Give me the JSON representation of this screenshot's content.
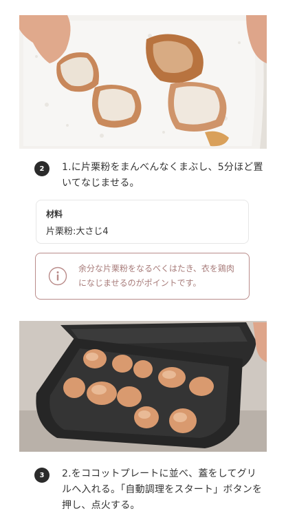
{
  "photos": [
    {
      "name": "photo-dredging-chicken",
      "alt": ""
    },
    {
      "name": "photo-grill-plate",
      "alt": ""
    }
  ],
  "steps": [
    {
      "number": "2",
      "text": "1.に片栗粉をまんべんなくまぶし、5分ほど置いてなじませる。"
    },
    {
      "number": "3",
      "text": "2.をココットプレートに並べ、蓋をしてグリルへ入れる。「自動調理をスタート」ボタンを押し、点火する。"
    }
  ],
  "ingredients": {
    "title": "材料",
    "items": [
      "片栗粉:大さじ4"
    ]
  },
  "tip": {
    "icon": "info-icon",
    "text": "余分な片栗粉をなるべくはたき、衣を鶏肉になじませるのがポイントです。"
  },
  "colors": {
    "tip_border": "#b98b89",
    "tip_text": "#a77b79",
    "badge": "#2b2b2b"
  }
}
